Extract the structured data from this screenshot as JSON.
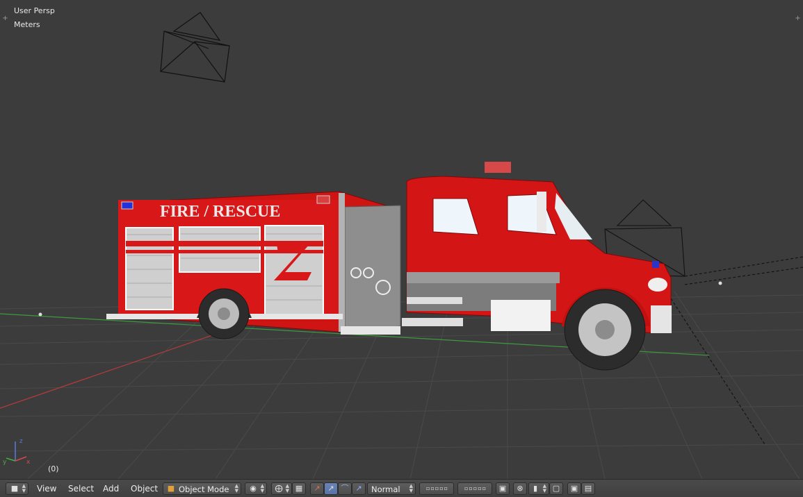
{
  "viewport": {
    "view_name": "User Persp",
    "units": "Meters",
    "frame": "(0)",
    "axis_labels": {
      "x": "x",
      "y": "y",
      "z": "z"
    },
    "truck_text": "FIRE / RESCUE",
    "colors": {
      "background": "#3c3c3c",
      "grid": "#4b4b4b",
      "x_axis": "#b53b3b",
      "y_axis": "#3f9a3f",
      "truck_red": "#d11414",
      "truck_grey": "#8d8d8d"
    }
  },
  "header": {
    "menus": {
      "view": "View",
      "select": "Select",
      "add": "Add",
      "object": "Object"
    },
    "mode_label": "Object Mode",
    "orientation_label": "Normal"
  }
}
